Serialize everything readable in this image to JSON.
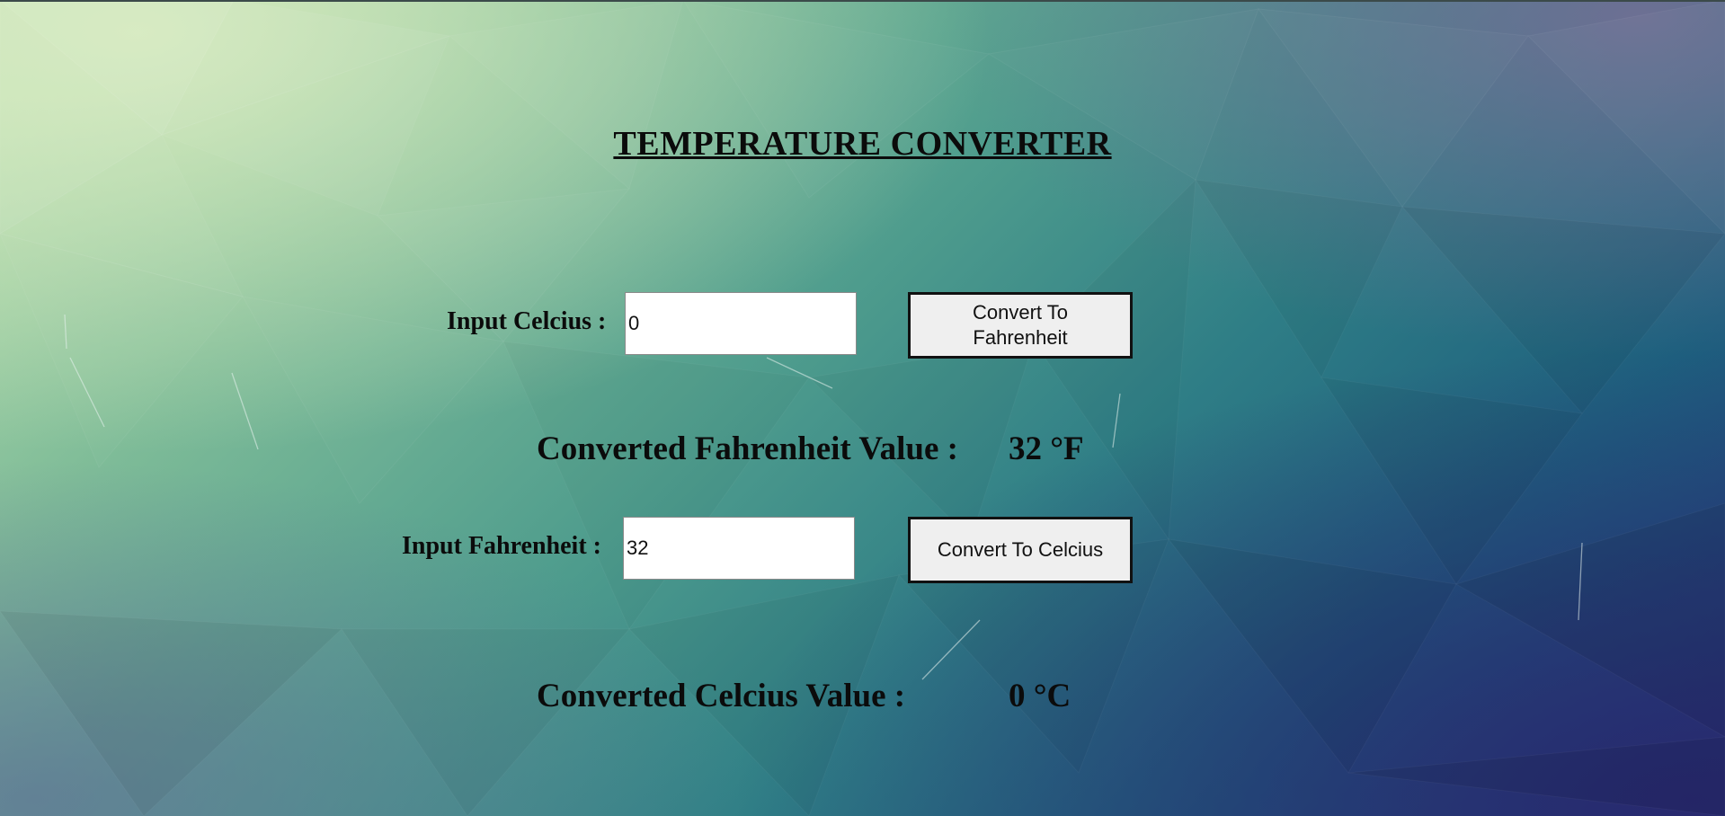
{
  "page": {
    "title": "TEMPERATURE CONVERTER"
  },
  "celsius_section": {
    "label": "Input Celcius :",
    "value": "0",
    "button_label": "Convert To Fahrenheit",
    "result_label": "Converted Fahrenheit Value :",
    "result_value": "32 °F"
  },
  "fahrenheit_section": {
    "label": "Input Fahrenheit :",
    "value": "32",
    "button_label": "Convert To Celcius",
    "result_label": "Converted Celcius Value :",
    "result_value": "0 °C"
  },
  "theme": {
    "text_color": "#0b0b0b",
    "button_bg": "#efefef",
    "button_border": "#111111",
    "input_bg": "#ffffff"
  }
}
